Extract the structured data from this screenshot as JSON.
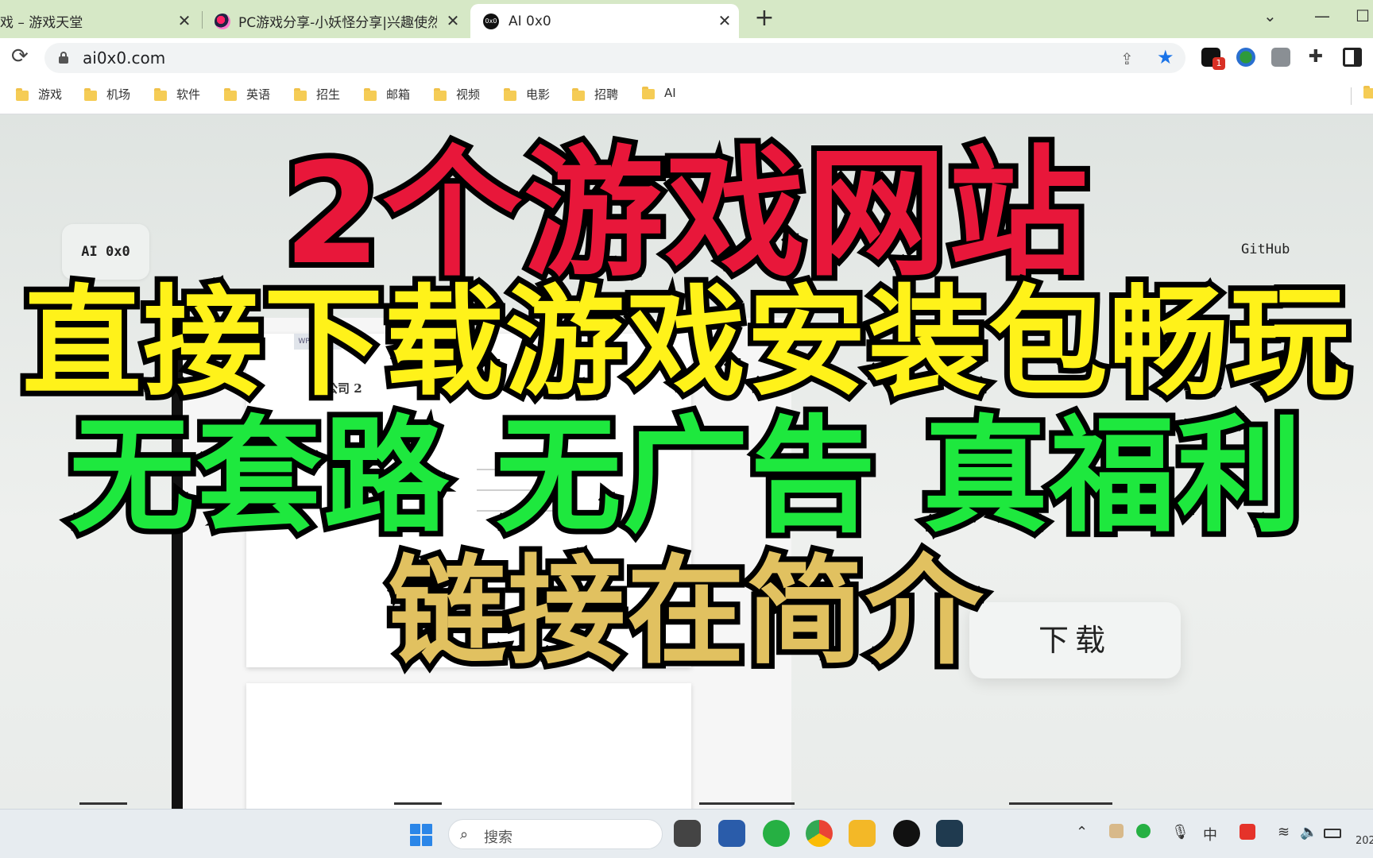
{
  "browser": {
    "tabs": [
      {
        "title": "戏 – 游戏天堂",
        "close": "✕"
      },
      {
        "title": "PC游戏分享-小妖怪分享|兴趣使然的",
        "close": "✕"
      },
      {
        "title": "AI 0x0",
        "favicon_text": "0x0",
        "close": "✕"
      }
    ],
    "new_tab": "+",
    "window_controls": {
      "list": "⌄",
      "minimize": "—",
      "maximize": "☐"
    },
    "url": "ai0x0.com",
    "extension_badge": "1",
    "bookmarks": [
      "游戏",
      "机场",
      "软件",
      "英语",
      "招生",
      "邮箱",
      "视频",
      "电影",
      "招聘",
      "AI"
    ]
  },
  "site": {
    "logo": "AI 0x0",
    "nav_link": "GitHub",
    "download_button": "下载",
    "doc_preview": {
      "app_tag": "WPS Office",
      "heading": "公司 2"
    }
  },
  "overlay": {
    "line1": "2个游戏网站",
    "line2": "直接下载游戏安装包畅玩",
    "line3": "无套路 无广告 真福利",
    "line4": "链接在简介"
  },
  "taskbar": {
    "search_placeholder": "搜索",
    "tray": {
      "ime": "中",
      "clock": "202"
    }
  },
  "colors": {
    "tab_strip": "#d6e8c6",
    "overlay_red": "#e8173a",
    "overlay_yellow": "#fff21a",
    "overlay_green": "#1ee83e",
    "overlay_gold": "#e1c160",
    "accent_blue": "#1a73e8"
  },
  "icons": [
    "reload-icon",
    "lock-icon",
    "share-icon",
    "star-icon",
    "extension-puzzle-icon",
    "sidebar-icon",
    "folder-icon",
    "windows-start-icon",
    "search-icon",
    "chrome-icon",
    "file-explorer-icon",
    "wechat-icon",
    "wifi-icon",
    "volume-icon",
    "battery-icon"
  ]
}
